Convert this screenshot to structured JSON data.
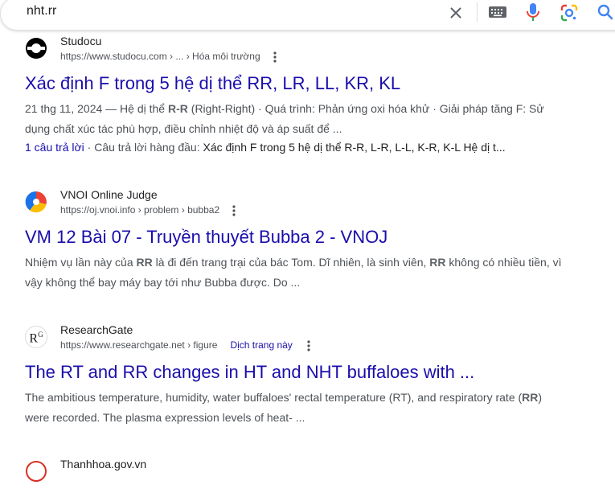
{
  "search": {
    "query": "nht.rr"
  },
  "icons": {
    "clear": "close-icon",
    "keyboard": "keyboard-icon",
    "voice": "mic-icon",
    "lens": "google-lens-icon",
    "search": "search-icon"
  },
  "colors": {
    "link": "#1a0dab",
    "snippet": "#4d5156",
    "mic": "#4285f4"
  },
  "results": [
    {
      "site_name": "Studocu",
      "url": "https://www.studocu.com › ... › Hóa môi trường",
      "title": "Xác định F trong 5 hệ dị thể RR, LR, LL, KR, KL",
      "snippet_date": "21 thg 11, 2024 —",
      "snippet_pre": " Hệ dị thể ",
      "snippet_bold1": "R-R",
      "snippet_post1": " (Right-Right) · Quá trình: Phản ứng oxi hóa khử · Giải pháp tăng F: Sử dụng chất xúc tác phù hợp, điều chỉnh nhiệt độ và áp suất để ...",
      "answers_link": "1 câu trả lời",
      "answers_label": "· Câu trả lời hàng đầu: ",
      "answers_text": "Xác định F trong 5 hệ dị thể R-R, L-R, L-L, K-R, K-L Hệ dị t..."
    },
    {
      "site_name": "VNOI Online Judge",
      "url": "https://oj.vnoi.info › problem › bubba2",
      "title": "VM 12 Bài 07 - Truyền thuyết Bubba 2 - VNOJ",
      "snippet_pre": "Nhiệm vụ lần này của ",
      "snippet_bold1": "RR",
      "snippet_mid": " là đi đến trang trại của bác Tom. Dĩ nhiên, là sinh viên, ",
      "snippet_bold2": "RR",
      "snippet_post": " không có nhiều tiền, vì vậy không thể bay máy bay tới như Bubba được. Do ..."
    },
    {
      "site_name": "ResearchGate",
      "favicon_text": "R",
      "favicon_sup": "G",
      "url": "https://www.researchgate.net › figure",
      "translate": "Dịch trang này",
      "title": "The RT and RR changes in HT and NHT buffaloes with ...",
      "snippet_pre": "The ambitious temperature, humidity, water buffaloes' rectal temperature (RT), and respiratory rate (",
      "snippet_bold1": "RR",
      "snippet_post": ") were recorded. The plasma expression levels of heat- ..."
    },
    {
      "site_name": "Thanhhoa.gov.vn"
    }
  ]
}
